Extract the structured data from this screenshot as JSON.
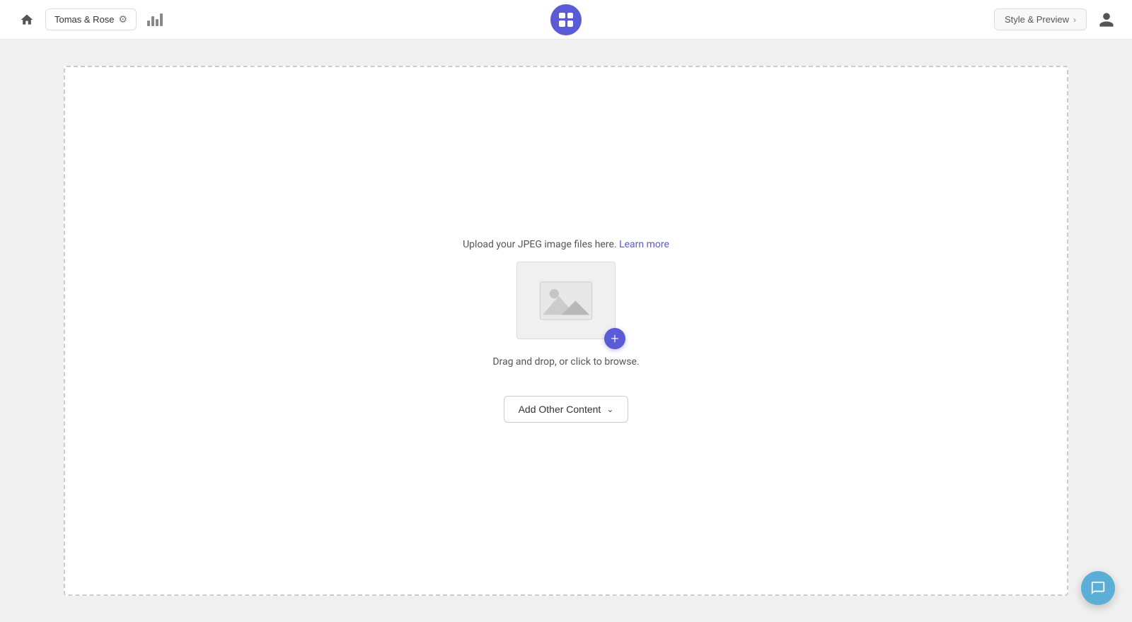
{
  "header": {
    "workspace_label": "Tomas & Rose",
    "style_preview_label": "Style & Preview",
    "logo_aria": "App Logo"
  },
  "main": {
    "upload_text": "Upload your JPEG image files here.",
    "learn_more_label": "Learn more",
    "drag_drop_text": "Drag and drop, or click to browse.",
    "add_content_label": "Add Other Content"
  },
  "chat": {
    "aria": "Open Chat"
  }
}
